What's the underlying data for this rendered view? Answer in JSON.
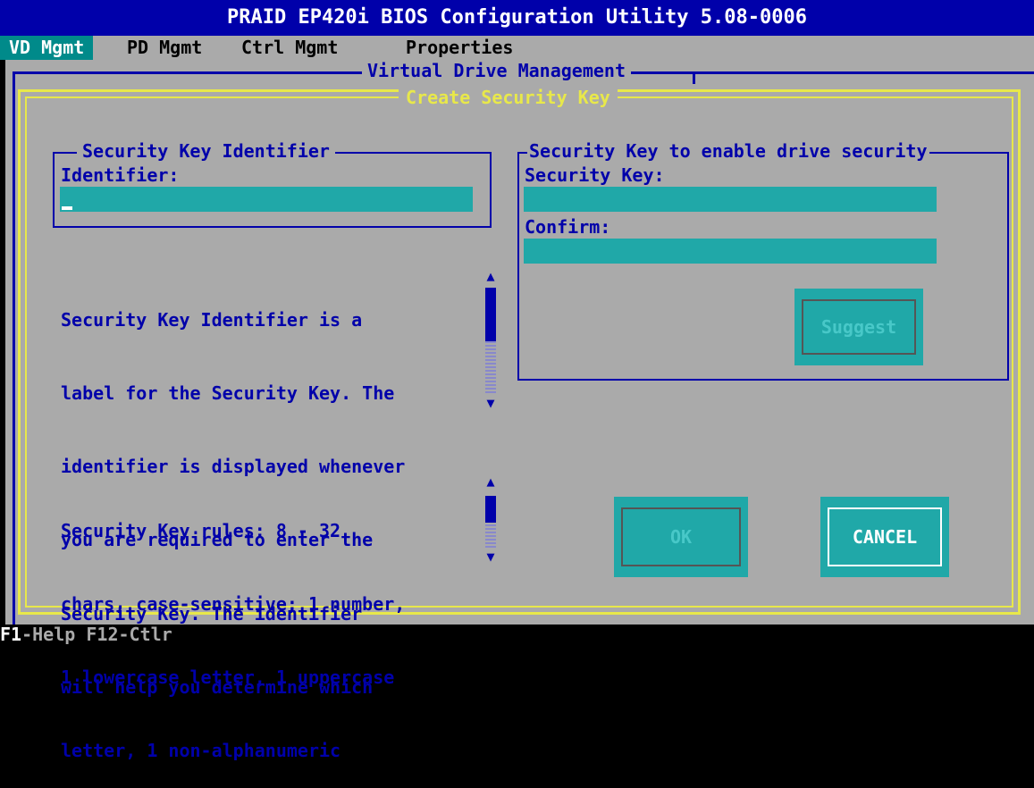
{
  "window": {
    "title": "PRAID EP420i BIOS Configuration Utility 5.08-0006"
  },
  "menu": {
    "items": [
      {
        "label": "VD Mgmt",
        "active": true
      },
      {
        "label": "PD Mgmt",
        "active": false
      },
      {
        "label": "Ctrl Mgmt",
        "active": false
      },
      {
        "label": "Properties",
        "active": false
      }
    ]
  },
  "vd_panel": {
    "title": "Virtual Drive Management"
  },
  "dialog": {
    "title": "Create Security Key",
    "identifier_group": {
      "legend": "Security Key Identifier",
      "field_label": "Identifier:",
      "value": ""
    },
    "help_identifier": {
      "lines": [
        "Security Key Identifier is a",
        "label for the Security Key. The",
        "identifier is displayed whenever",
        "you are required to enter the",
        "Security Key. The identifier",
        "will help you determine which"
      ]
    },
    "help_rules": {
      "lines": [
        "Security Key rules: 8 - 32",
        "chars, case-sensitive; 1 number,",
        "1 lowercase letter, 1 uppercase",
        "letter, 1 non-alphanumeric"
      ]
    },
    "key_group": {
      "legend": "Security Key to enable drive security",
      "key_label": "Security Key:",
      "key_value": "",
      "confirm_label": "Confirm:",
      "confirm_value": "",
      "suggest_label": "Suggest"
    },
    "ok_label": "OK",
    "cancel_label": "CANCEL"
  },
  "scroll_arrows": {
    "up": "▲",
    "down": "▼"
  },
  "status_bar": {
    "f1_key": "F1",
    "f1_action": "-Help",
    "f12_hint": "F12-Ctlr"
  },
  "colors": {
    "title_bg": "#0000aa",
    "panel_bg": "#aaaaaa",
    "field_bg": "#20a8a8",
    "dialog_border": "#e8e84a",
    "text_blue": "#0000aa",
    "active_menu_bg": "#008a8a"
  }
}
